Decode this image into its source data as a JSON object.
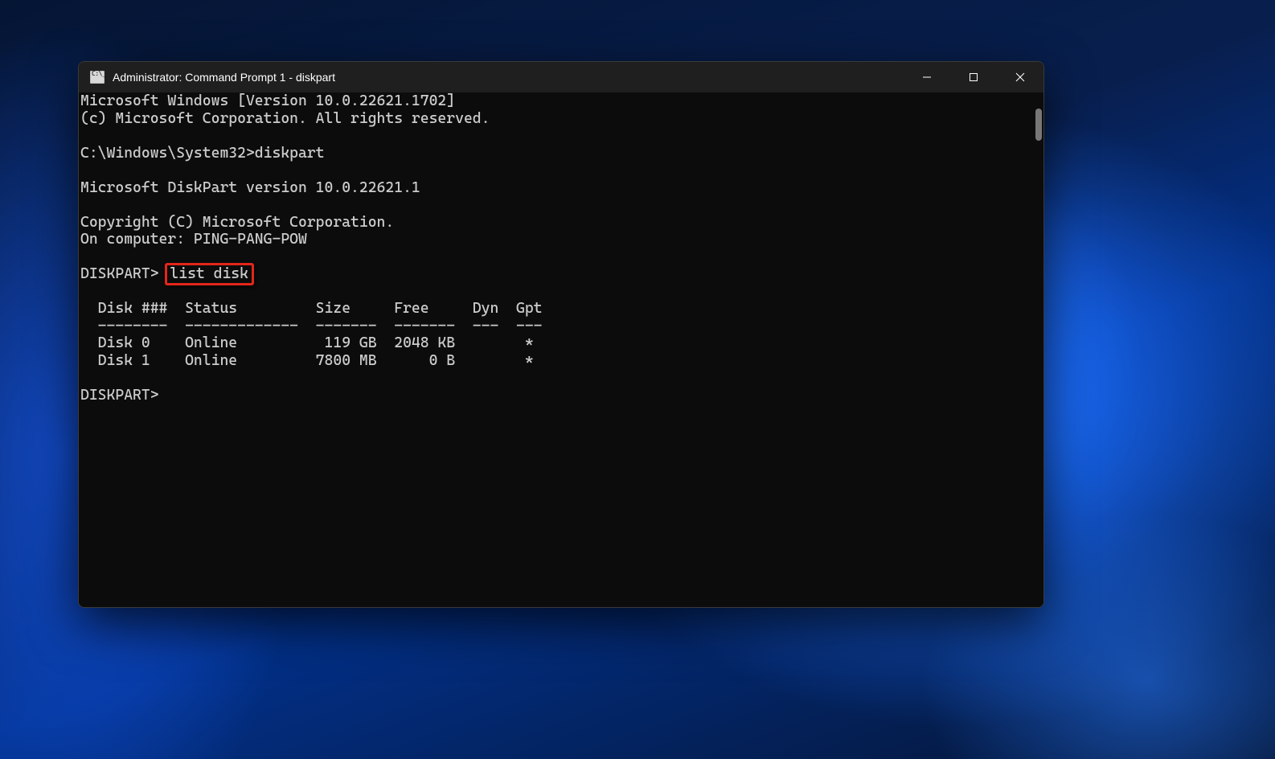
{
  "window": {
    "title": "Administrator: Command Prompt 1 - diskpart"
  },
  "terminal": {
    "banner1": "Microsoft Windows [Version 10.0.22621.1702]",
    "banner2": "(c) Microsoft Corporation. All rights reserved.",
    "prompt1_path": "C:\\Windows\\System32>",
    "prompt1_cmd": "diskpart",
    "diskpart_banner": "Microsoft DiskPart version 10.0.22621.1",
    "copyright": "Copyright (C) Microsoft Corporation.",
    "computer_line_prefix": "On computer: ",
    "computer_name": "PING-PANG-POW",
    "dp_prompt": "DISKPART>",
    "dp_cmd": "list disk",
    "table_header": "  Disk ###  Status         Size     Free     Dyn  Gpt",
    "table_divider": "  --------  -------------  -------  -------  ---  ---",
    "table_row0": "  Disk 0    Online          119 GB  2048 KB        *",
    "table_row1": "  Disk 1    Online         7800 MB      0 B        *",
    "dp_prompt2": "DISKPART>"
  },
  "table_data": {
    "columns": [
      "Disk ###",
      "Status",
      "Size",
      "Free",
      "Dyn",
      "Gpt"
    ],
    "rows": [
      {
        "disk": "Disk 0",
        "status": "Online",
        "size": "119 GB",
        "free": "2048 KB",
        "dyn": "",
        "gpt": "*"
      },
      {
        "disk": "Disk 1",
        "status": "Online",
        "size": "7800 MB",
        "free": "0 B",
        "dyn": "",
        "gpt": "*"
      }
    ]
  }
}
